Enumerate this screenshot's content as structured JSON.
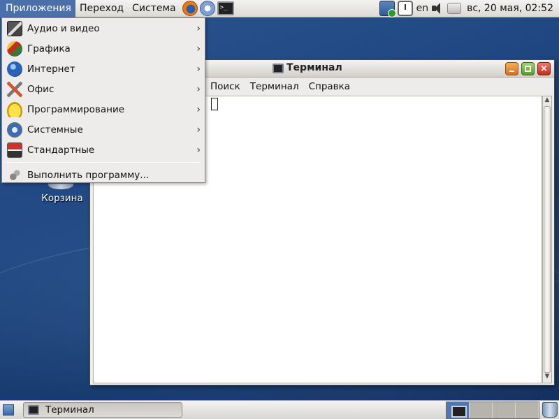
{
  "top_panel": {
    "menus": [
      "Приложения",
      "Переход",
      "Система"
    ],
    "launchers": [
      "firefox-icon",
      "mail-icon",
      "terminal-icon"
    ],
    "tray": {
      "icons": [
        "network-icon",
        "clock-app-icon",
        "volume-icon",
        "printer-icon"
      ],
      "language": "en",
      "clock": "вс, 20 мая, 02:52"
    }
  },
  "apps_menu": {
    "items": [
      {
        "label": "Аудио и видео",
        "icon": "film-icon"
      },
      {
        "label": "Графика",
        "icon": "palette-icon"
      },
      {
        "label": "Интернет",
        "icon": "globe-icon"
      },
      {
        "label": "Офис",
        "icon": "office-tools-icon"
      },
      {
        "label": "Программирование",
        "icon": "hardhat-icon"
      },
      {
        "label": "Системные",
        "icon": "system-gear-icon"
      },
      {
        "label": "Стандартные",
        "icon": "calculator-icon"
      }
    ],
    "arrow": "›",
    "run_program": {
      "label": "Выполнить программу...",
      "icon": "run-icon"
    }
  },
  "desktop": {
    "trash_label": "Корзина"
  },
  "terminal_window": {
    "title": "Терминал",
    "close_glyph": "×",
    "menu": [
      "Поиск",
      "Терминал",
      "Справка"
    ],
    "scroll_up": "▲",
    "scroll_down": "▼"
  },
  "bottom_panel": {
    "task": {
      "label": "Терминал"
    },
    "workspaces": 4,
    "active_workspace": 1
  },
  "colors": {
    "menu_highlight": "#4a6fa9",
    "desktop": "#1f4680"
  }
}
